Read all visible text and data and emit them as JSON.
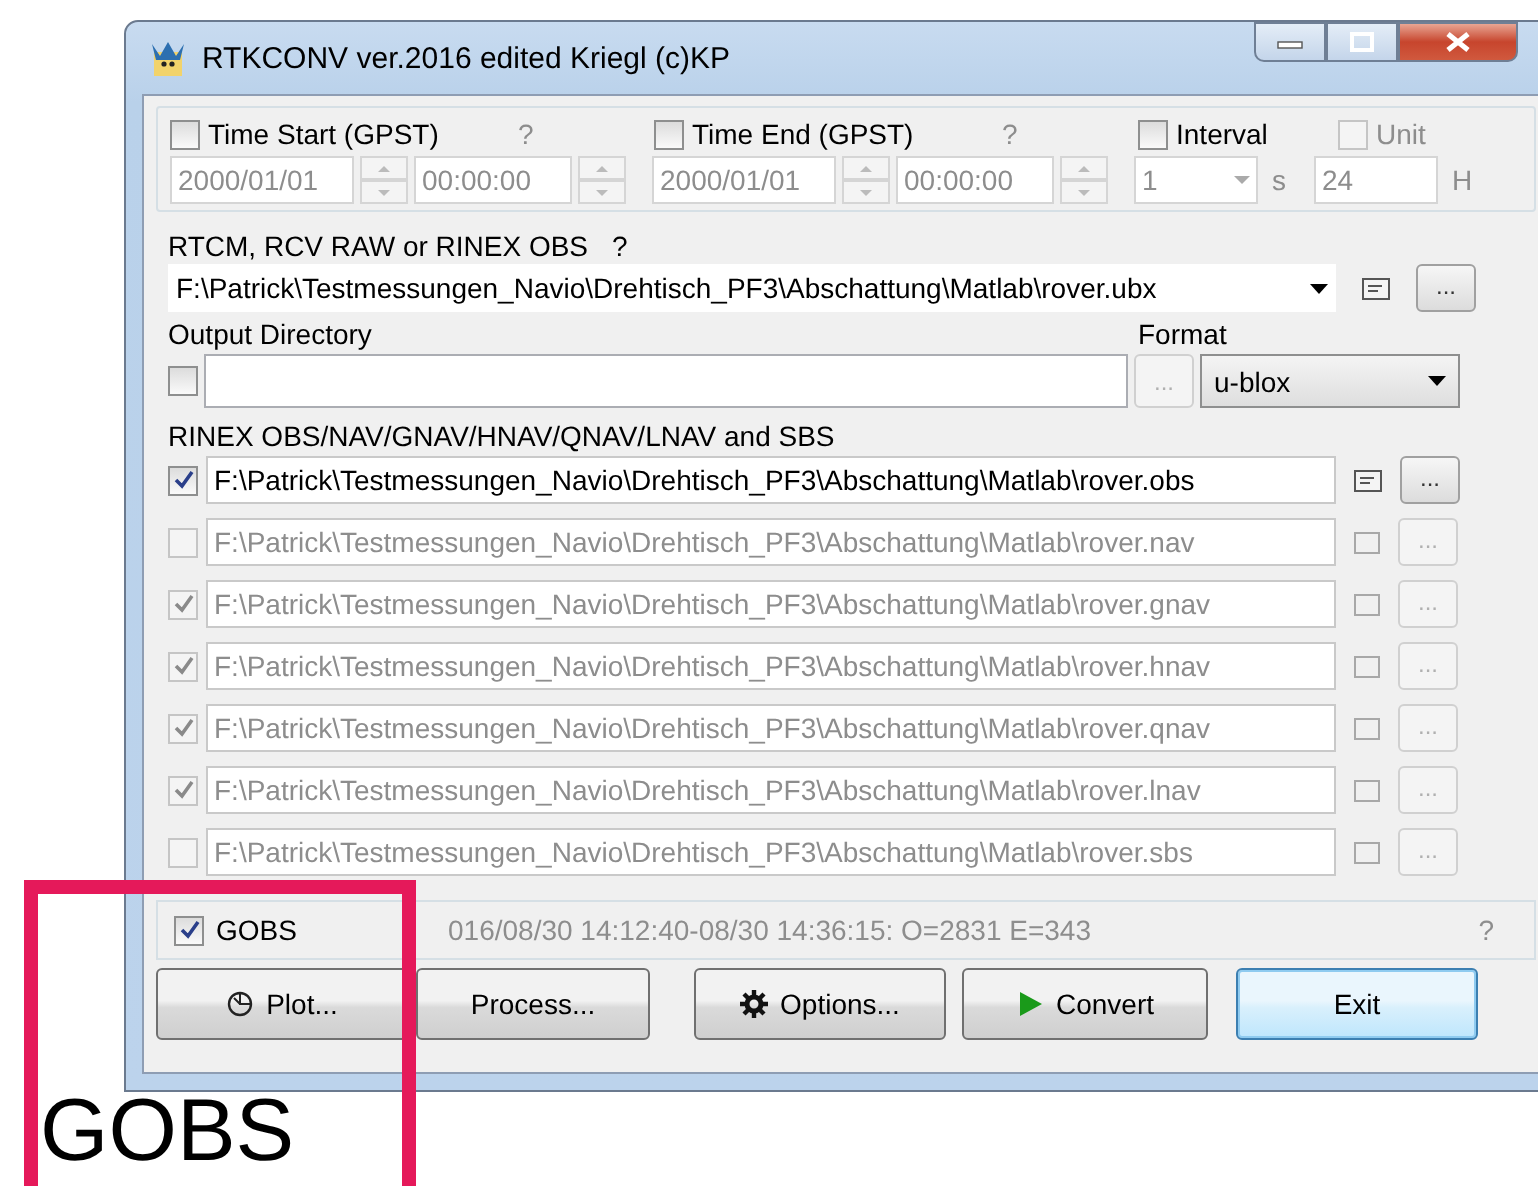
{
  "window": {
    "title": "RTKCONV ver.2016 edited Kriegl (c)KP"
  },
  "time": {
    "start": {
      "label": "Time Start (GPST)",
      "help": "?",
      "checked": false,
      "date": "2000/01/01",
      "time": "00:00:00"
    },
    "end": {
      "label": "Time End (GPST)",
      "help": "?",
      "checked": false,
      "date": "2000/01/01",
      "time": "00:00:00"
    },
    "interval": {
      "label": "Interval",
      "checked": false,
      "value": "1",
      "unit": "s"
    },
    "unit": {
      "label": "Unit",
      "checked": false,
      "value": "24",
      "unit": "H"
    }
  },
  "input": {
    "label": "RTCM, RCV RAW or RINEX OBS",
    "help": "?",
    "value": "F:\\Patrick\\Testmessungen_Navio\\Drehtisch_PF3\\Abschattung\\Matlab\\rover.ubx",
    "browse": "..."
  },
  "output_dir": {
    "label": "Output Directory",
    "checked": false,
    "browse": "..."
  },
  "format": {
    "label": "Format",
    "value": "u-blox"
  },
  "outputs_label": "RINEX OBS/NAV/GNAV/HNAV/QNAV/LNAV and SBS",
  "outputs": [
    {
      "path": "F:\\Patrick\\Testmessungen_Navio\\Drehtisch_PF3\\Abschattung\\Matlab\\rover.obs",
      "checked": true,
      "disabled": false,
      "browse": "..."
    },
    {
      "path": "F:\\Patrick\\Testmessungen_Navio\\Drehtisch_PF3\\Abschattung\\Matlab\\rover.nav",
      "checked": false,
      "disabled": true,
      "browse": "..."
    },
    {
      "path": "F:\\Patrick\\Testmessungen_Navio\\Drehtisch_PF3\\Abschattung\\Matlab\\rover.gnav",
      "checked": true,
      "disabled": true,
      "browse": "..."
    },
    {
      "path": "F:\\Patrick\\Testmessungen_Navio\\Drehtisch_PF3\\Abschattung\\Matlab\\rover.hnav",
      "checked": true,
      "disabled": true,
      "browse": "..."
    },
    {
      "path": "F:\\Patrick\\Testmessungen_Navio\\Drehtisch_PF3\\Abschattung\\Matlab\\rover.qnav",
      "checked": true,
      "disabled": true,
      "browse": "..."
    },
    {
      "path": "F:\\Patrick\\Testmessungen_Navio\\Drehtisch_PF3\\Abschattung\\Matlab\\rover.lnav",
      "checked": true,
      "disabled": true,
      "browse": "..."
    },
    {
      "path": "F:\\Patrick\\Testmessungen_Navio\\Drehtisch_PF3\\Abschattung\\Matlab\\rover.sbs",
      "checked": false,
      "disabled": true,
      "browse": "..."
    }
  ],
  "status": {
    "gobs_label": "GOBS",
    "gobs_checked": true,
    "message": "016/08/30 14:12:40-08/30 14:36:15: O=2831 E=343",
    "help": "?"
  },
  "buttons": [
    {
      "kind": "plot",
      "label": "Plot...",
      "selected": false
    },
    {
      "kind": "process",
      "label": "Process...",
      "selected": false
    },
    {
      "kind": "options",
      "label": "Options...",
      "selected": false
    },
    {
      "kind": "convert",
      "label": "Convert",
      "selected": false
    },
    {
      "kind": "exit",
      "label": "Exit",
      "selected": true
    }
  ],
  "annotation": {
    "label": "GOBS"
  }
}
